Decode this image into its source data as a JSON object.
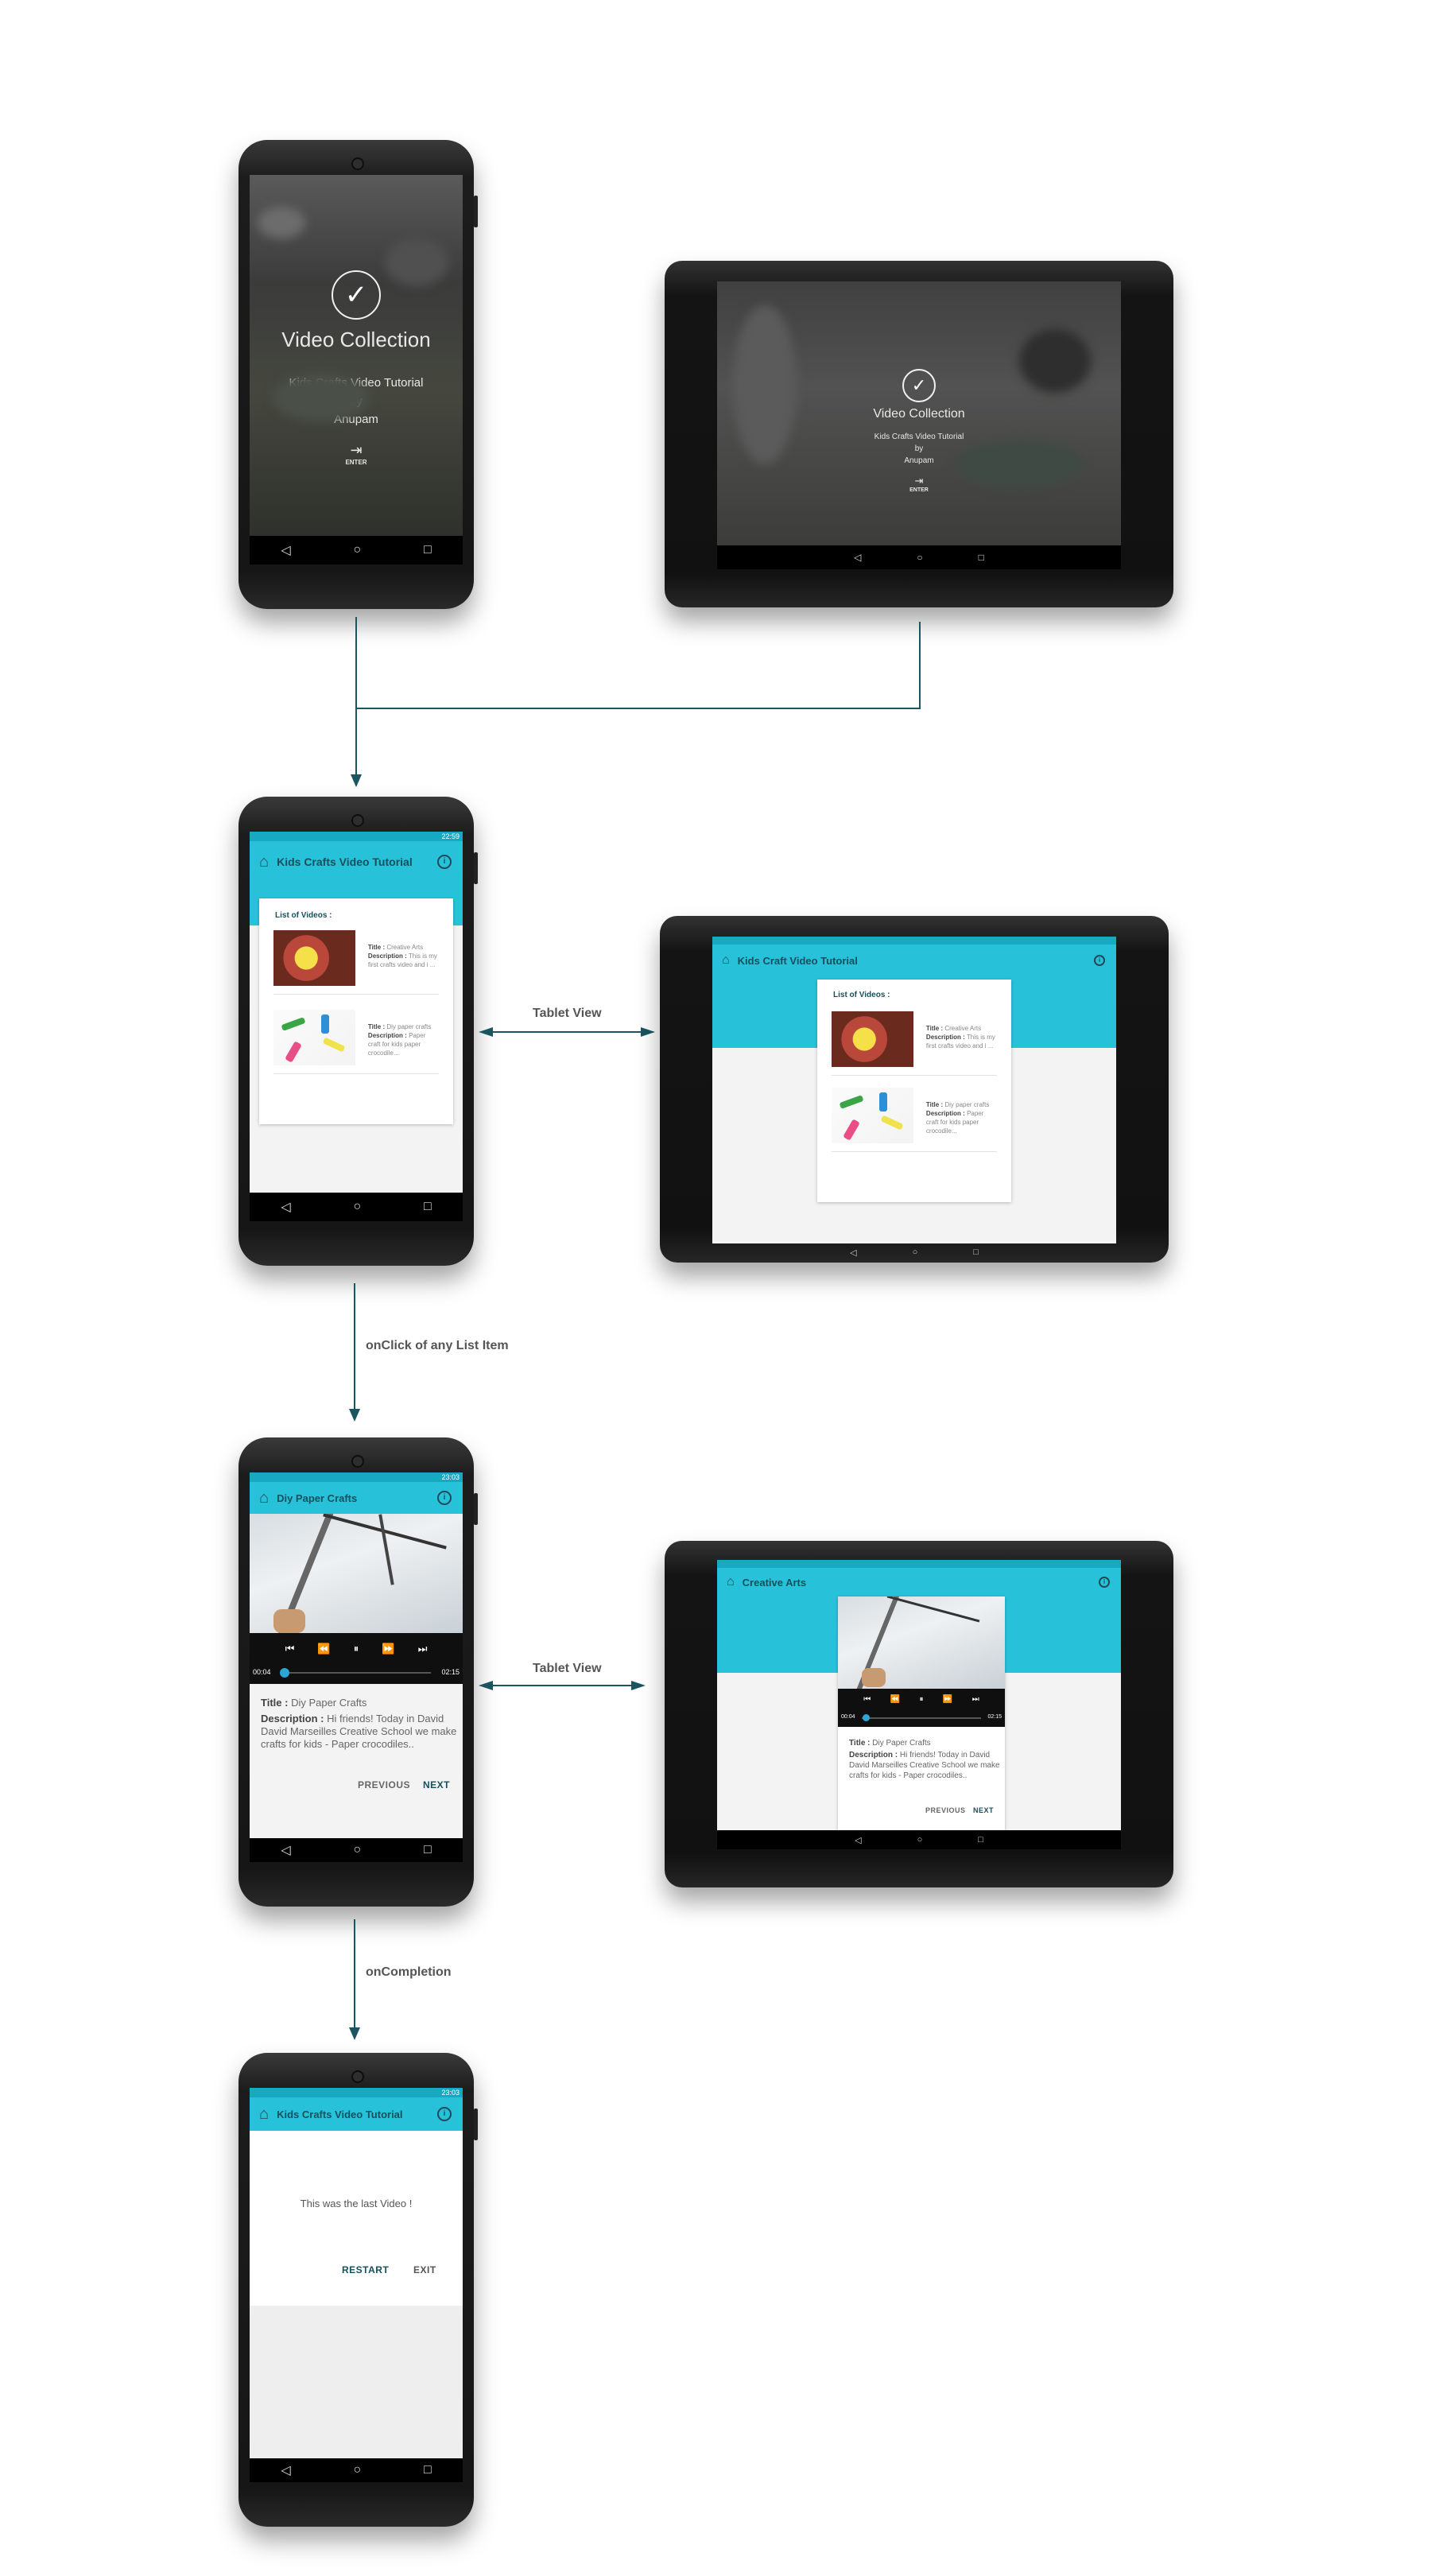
{
  "splash": {
    "title": "Video Collection",
    "subtitle": "Kids Crafts Video Tutorial",
    "by": "by",
    "author": "Anupam",
    "enter_label": "ENTER"
  },
  "list_screen": {
    "time": "22:59",
    "app_title": "Kids Crafts Video Tutorial",
    "section_title": "List of Videos :",
    "items": [
      {
        "title_label": "Title :",
        "title": "Creative Arts",
        "desc_label": "Description :",
        "desc": "This is my first crafts video and i ..."
      },
      {
        "title_label": "Title :",
        "title": "Diy paper crafts",
        "desc_label": "Description :",
        "desc": "Paper craft for kids paper crocodile..."
      }
    ]
  },
  "tablet_list": {
    "app_title": "Kids Craft Video Tutorial",
    "section_title": "List of Videos :",
    "items": [
      {
        "title_label": "Title :",
        "title": "Creative Arts",
        "desc_label": "Description :",
        "desc": "This is my first crafts video and i ..."
      },
      {
        "title_label": "Title :",
        "title": "Diy paper crafts",
        "desc_label": "Description :",
        "desc": "Paper craft for kids paper crocodile..."
      }
    ]
  },
  "player_screen": {
    "time": "23:03",
    "app_title": "Diy Paper Crafts",
    "elapsed": "00:04",
    "duration": "02:15",
    "progress_fraction": 0.03,
    "title_label": "Title :",
    "title": "Diy Paper Crafts",
    "desc_label": "Description :",
    "desc": "Hi friends! Today in David David Marseilles Creative  School we make crafts for kids - Paper crocodiles..",
    "previous": "PREVIOUS",
    "next": "NEXT"
  },
  "tablet_player": {
    "app_title": "Creative Arts",
    "elapsed": "00:04",
    "duration": "02:15",
    "title_label": "Title :",
    "title": "Diy Paper Crafts",
    "desc_label": "Description :",
    "desc": "Hi friends! Today in David David Marseilles Creative  School we make crafts for kids - Paper crocodiles..",
    "previous": "PREVIOUS",
    "next": "NEXT"
  },
  "end_screen": {
    "time": "23:03",
    "app_title": "Kids Crafts Video Tutorial",
    "message": "This was the last Video !",
    "restart": "RESTART",
    "exit": "EXIT"
  },
  "flow_labels": {
    "tablet_view_1": "Tablet View",
    "tablet_view_2": "Tablet View",
    "onclick": "onClick of any List Item",
    "oncompletion": "onCompletion"
  },
  "colors": {
    "accent": "#27c2da",
    "status": "#17a9c1",
    "flow_arrow": "#1a5560",
    "primary_text": "#15505c"
  },
  "icons": [
    "home-icon",
    "info-icon",
    "check-icon",
    "enter-icon",
    "back-nav-icon",
    "home-nav-icon",
    "recents-nav-icon",
    "skip-previous-icon",
    "rewind-icon",
    "pause-icon",
    "fast-forward-icon",
    "skip-next-icon"
  ]
}
